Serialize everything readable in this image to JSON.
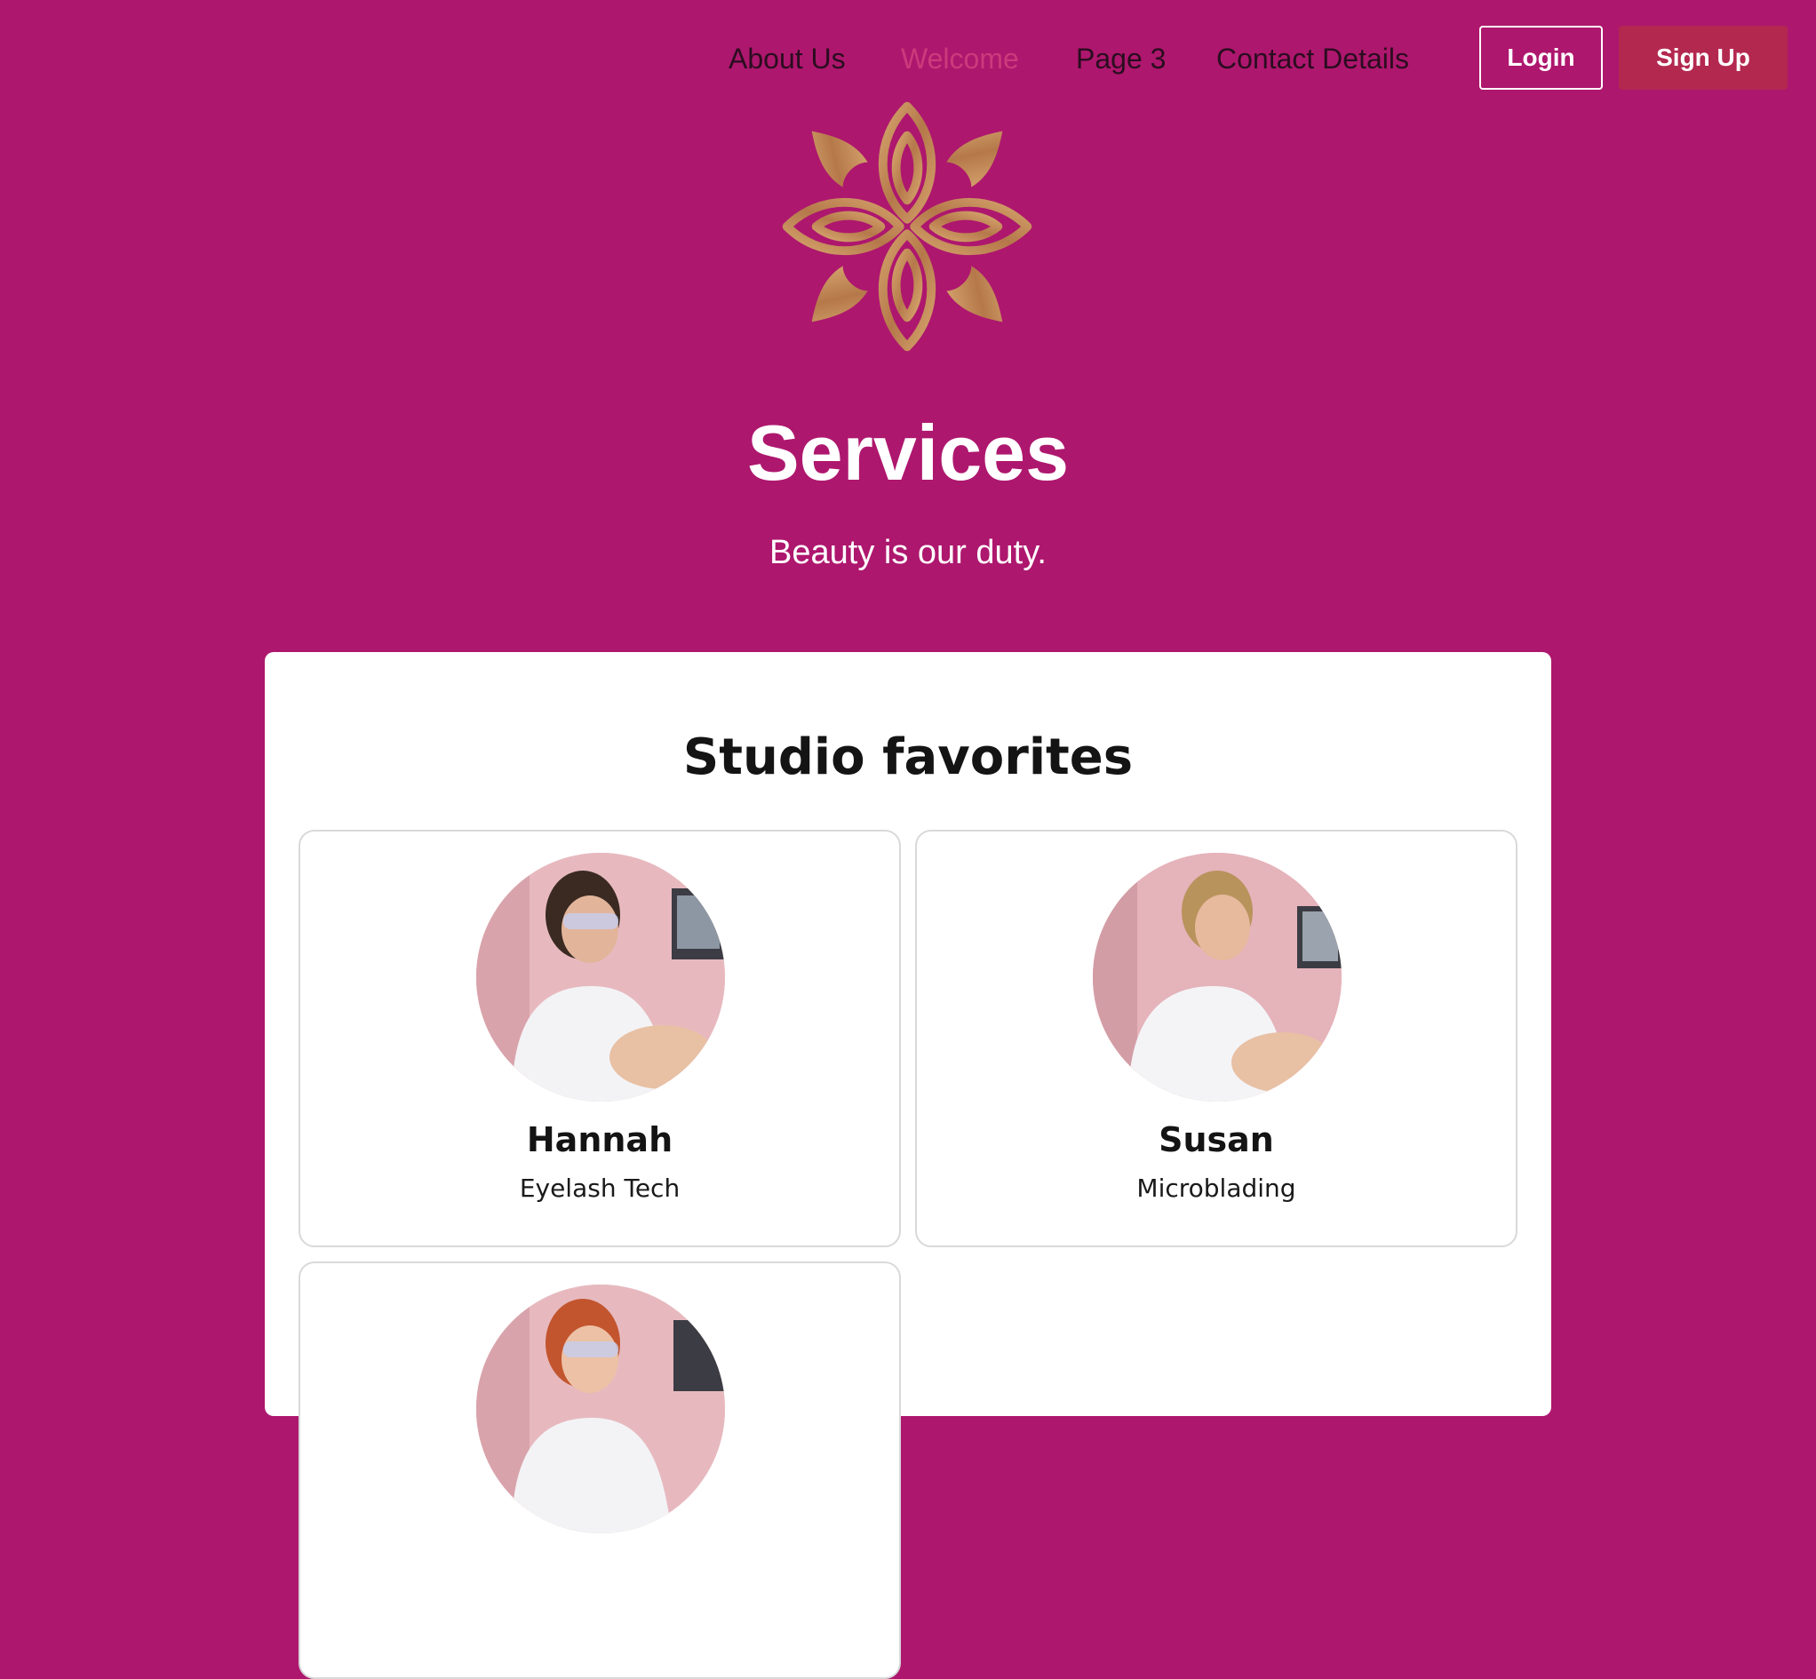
{
  "nav": {
    "links": [
      "About Us",
      "Welcome",
      "Page 3",
      "Contact Details"
    ],
    "active_link": "Welcome",
    "login_label": "Login",
    "signup_label": "Sign Up"
  },
  "hero": {
    "logo_icon": "lotus-flower-icon",
    "title": "Services",
    "subtitle": "Beauty is our duty."
  },
  "favorites": {
    "title": "Studio favorites",
    "cards": [
      {
        "name": "Hannah",
        "role": "Eyelash Tech",
        "photo": "technician-photo"
      },
      {
        "name": "Susan",
        "role": "Microblading",
        "photo": "technician-photo"
      },
      {
        "name": "",
        "role": "",
        "photo": "technician-photo"
      }
    ]
  },
  "colors": {
    "background": "#ae176e",
    "accent_button": "#b3284f",
    "logo_gold": "#c08a55",
    "active_nav": "#cc3a7c",
    "card_border": "#d9d9d9"
  }
}
